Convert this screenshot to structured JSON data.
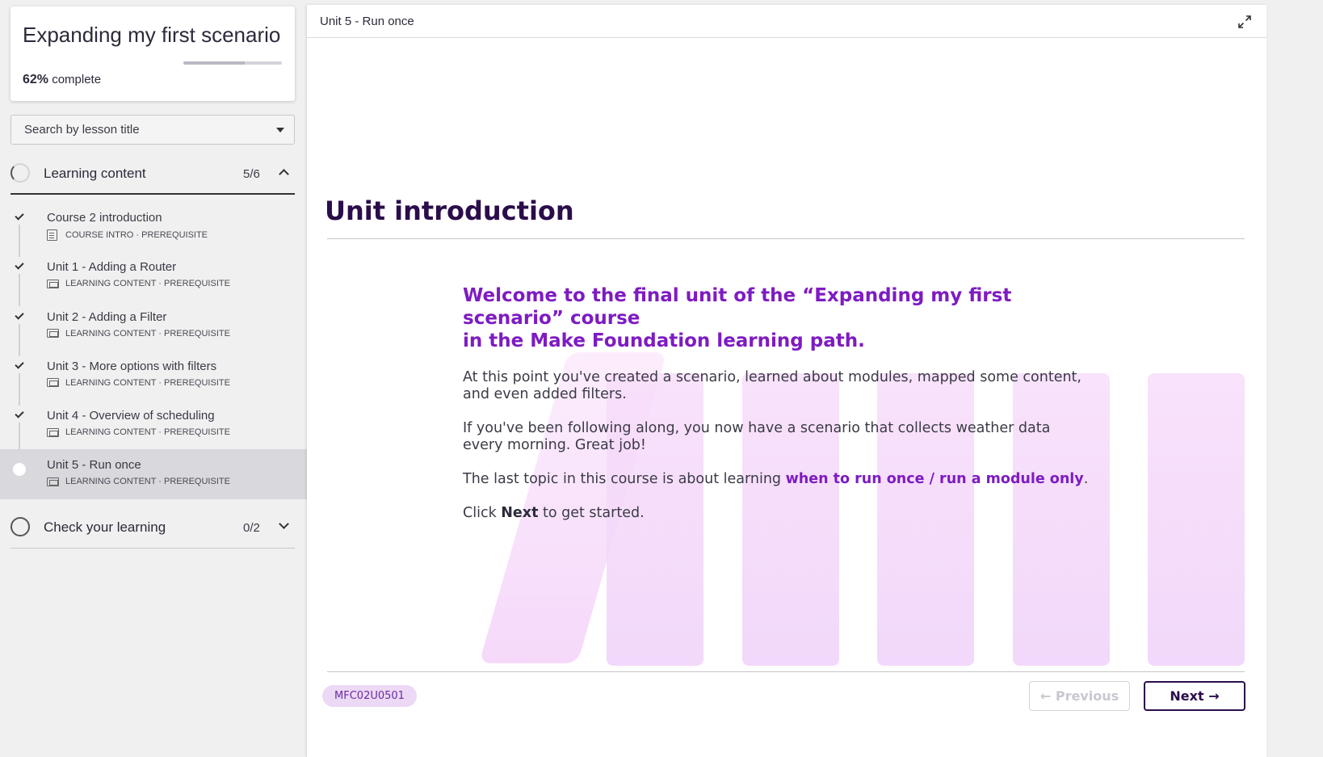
{
  "course": {
    "title": "Expanding my first scenario",
    "progress_value": 0.62,
    "progress_percent": "62%",
    "progress_suffix": " complete"
  },
  "search": {
    "label": "Search by lesson title"
  },
  "sections": [
    {
      "title": "Learning content",
      "count": "5/6",
      "expanded": true
    },
    {
      "title": "Check your learning",
      "count": "0/2",
      "expanded": false
    }
  ],
  "lessons": [
    {
      "title": "Course 2 introduction",
      "meta": "COURSE INTRO · PREREQUISITE",
      "icon": "document-icon",
      "done": true
    },
    {
      "title": "Unit 1 - Adding a Router",
      "meta": "LEARNING CONTENT · PREREQUISITE",
      "icon": "screen-icon",
      "done": true
    },
    {
      "title": "Unit 2 - Adding a Filter",
      "meta": "LEARNING CONTENT · PREREQUISITE",
      "icon": "screen-icon",
      "done": true
    },
    {
      "title": "Unit 3 - More options with filters",
      "meta": "LEARNING CONTENT · PREREQUISITE",
      "icon": "screen-icon",
      "done": true
    },
    {
      "title": "Unit 4 - Overview of scheduling",
      "meta": "LEARNING CONTENT · PREREQUISITE",
      "icon": "screen-icon",
      "done": true
    },
    {
      "title": "Unit 5 - Run once",
      "meta": "LEARNING CONTENT · PREREQUISITE",
      "icon": "screen-icon",
      "done": false,
      "active": true
    }
  ],
  "main": {
    "topbar_title": "Unit 5 - Run once",
    "heading": "Unit introduction",
    "welcome_line1": "Welcome to the final unit of the “Expanding my first scenario” course",
    "welcome_line2": "in the Make Foundation learning path.",
    "para1": "At this point you've created a scenario, learned about modules, mapped some content, and even added filters.",
    "para2": "If you've been following along, you now have a scenario that collects weather data every morning. Great job!",
    "para3_prefix": "The last topic in this course is about learning ",
    "para3_link": "when to run once / run a module only",
    "para3_suffix": ".",
    "para4_prefix": "Click ",
    "para4_bold": "Next",
    "para4_suffix": " to get started.",
    "code": "MFC02U0501",
    "prev_label": "← Previous",
    "next_label": "Next →"
  },
  "colors": {
    "accent_purple": "#7e1bc2",
    "dark_purple": "#2a0d4a",
    "badge_bg": "#ecd9f6"
  }
}
